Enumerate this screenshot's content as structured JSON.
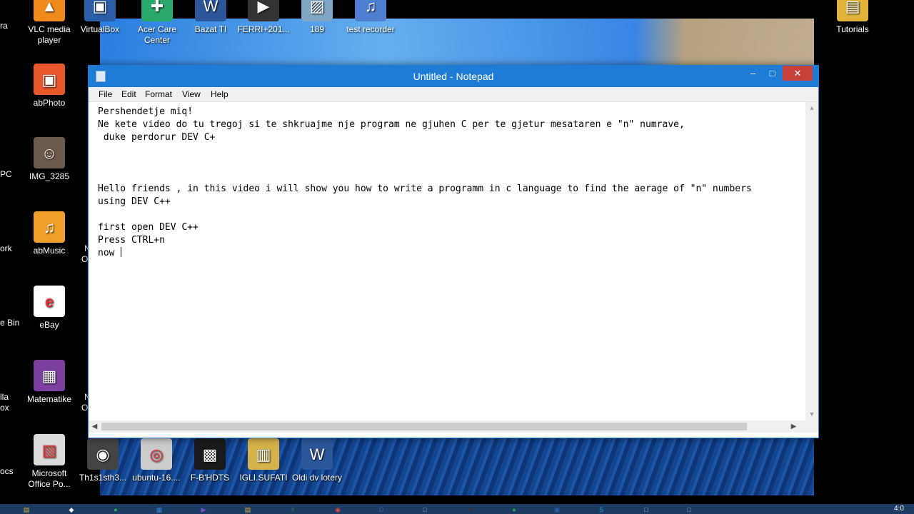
{
  "notepad": {
    "title": "Untitled - Notepad",
    "controls": {
      "minimize": "–",
      "maximize": "□",
      "close": "✕"
    },
    "menu": [
      "File",
      "Edit",
      "Format",
      "View",
      "Help"
    ],
    "text": "Pershendetje miq!\nNe kete video do tu tregoj si te shkruajme nje program ne gjuhen C per te gjetur mesataren e \"n\" numrave,\n duke perdorur DEV C+\n\n\n\nHello friends , in this video i will show you how to write a programm in c language to find the aerage of \"n\" numbers\nusing DEV C++\n\nfirst open DEV C++\nPress CTRL+n\nnow ",
    "scroll_arrows": {
      "up": "▲",
      "down": "▼",
      "left": "◀",
      "right": "▶"
    }
  },
  "desktop": {
    "icons": [
      {
        "name": "VLC media player",
        "glyph": "▲",
        "color": "#f08a1c"
      },
      {
        "name": "VirtualBox",
        "glyph": "▣",
        "color": "#2a5fa8"
      },
      {
        "name": "Acer Care Center",
        "glyph": "✚",
        "color": "#2aa86a"
      },
      {
        "name": "Bazat TI",
        "glyph": "W",
        "color": "#2b579a"
      },
      {
        "name": "FERRI+201...",
        "glyph": "▶",
        "color": "#333333"
      },
      {
        "name": "189",
        "glyph": "▨",
        "color": "#7fa6c4"
      },
      {
        "name": "test recorder",
        "glyph": "♫",
        "color": "#4f7fd0"
      },
      {
        "name": "Tutorials",
        "glyph": "▤",
        "color": "#e2b33a"
      },
      {
        "name": "abPhoto",
        "glyph": "▣",
        "color": "#e8582a"
      },
      {
        "name": "IMG_3285",
        "glyph": "☺",
        "color": "#6b5a4b"
      },
      {
        "name": "abMusic",
        "glyph": "♫",
        "color": "#f0a02a"
      },
      {
        "name": "eBay",
        "glyph": "e",
        "color": "#ffffff"
      },
      {
        "name": "Matematike",
        "glyph": "▦",
        "color": "#7b3fa0"
      },
      {
        "name": "Microsoft Office Po...",
        "glyph": "▧",
        "color": "#dcdcdc"
      },
      {
        "name": "Th1s1sth3...",
        "glyph": "◉",
        "color": "#444444"
      },
      {
        "name": "ubuntu-16....",
        "glyph": "◎",
        "color": "#cccccc"
      },
      {
        "name": "F-B'HDTS",
        "glyph": "▩",
        "color": "#1a1a1a"
      },
      {
        "name": "IGLI.SUFATI",
        "glyph": "▥",
        "color": "#d6b24a"
      },
      {
        "name": "Oldi dv lotery",
        "glyph": "W",
        "color": "#2b579a"
      }
    ],
    "edge_labels": [
      "ra",
      "PC",
      "ork",
      "e Bin",
      "lla",
      "ox",
      "ocs",
      "N",
      "O",
      "N",
      "O"
    ]
  },
  "taskbar": {
    "apps": [
      {
        "name": "file-explorer",
        "glyph": "▤",
        "color": "#e2b33a"
      },
      {
        "name": "start-app",
        "glyph": "◆",
        "color": "#ffffff"
      },
      {
        "name": "spotify",
        "glyph": "●",
        "color": "#1db954"
      },
      {
        "name": "calculator",
        "glyph": "▦",
        "color": "#3b7fd0"
      },
      {
        "name": "visual-studio",
        "glyph": "▶",
        "color": "#7b4fc9"
      },
      {
        "name": "folder",
        "glyph": "▤",
        "color": "#d8b040"
      },
      {
        "name": "excel",
        "glyph": "X",
        "color": "#1d7a45"
      },
      {
        "name": "chrome",
        "glyph": "◉",
        "color": "#d84a3a"
      },
      {
        "name": "dev-cpp",
        "glyph": "D",
        "color": "#3b5f9a"
      },
      {
        "name": "notepad",
        "glyph": "□",
        "color": "#8fb3d8"
      },
      {
        "name": "app-dark",
        "glyph": "■",
        "color": "#333333"
      },
      {
        "name": "xbox",
        "glyph": "●",
        "color": "#2aa84a"
      },
      {
        "name": "virtualbox",
        "glyph": "▣",
        "color": "#2a5fa8"
      },
      {
        "name": "skype",
        "glyph": "S",
        "color": "#1aa0e0"
      },
      {
        "name": "window-1",
        "glyph": "□",
        "color": "#8fb3d8"
      },
      {
        "name": "window-2",
        "glyph": "□",
        "color": "#8fb3d8"
      }
    ],
    "clock": "4:0"
  }
}
